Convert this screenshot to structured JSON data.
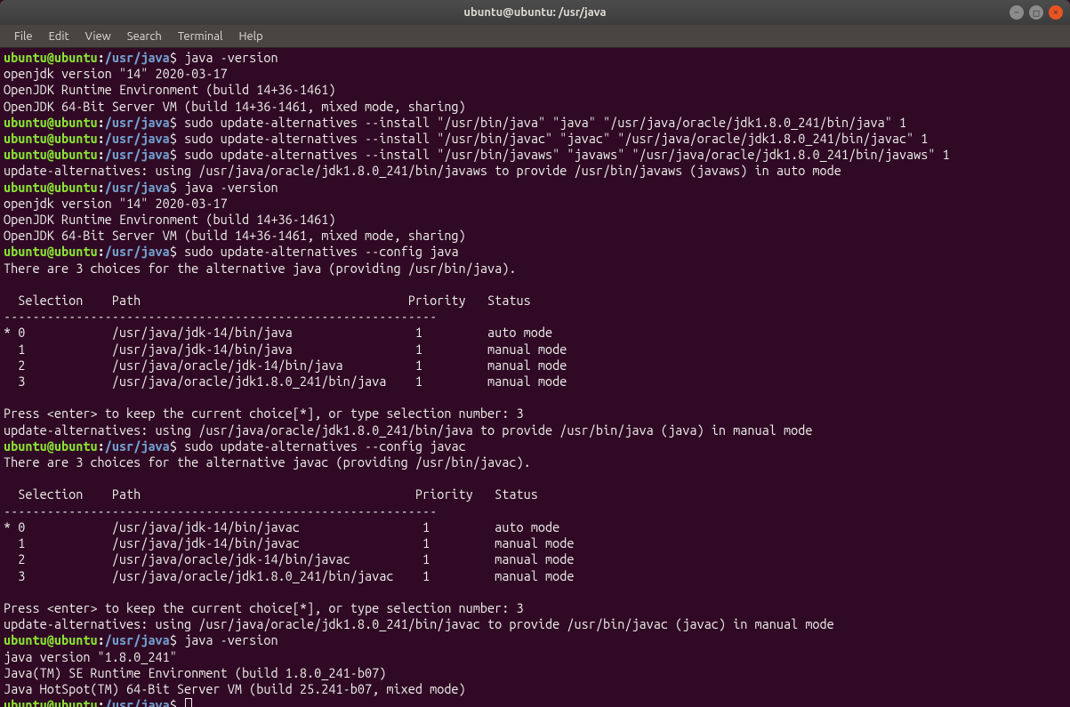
{
  "window": {
    "title": "ubuntu@ubuntu: /usr/java"
  },
  "menubar": {
    "items": [
      "File",
      "Edit",
      "View",
      "Search",
      "Terminal",
      "Help"
    ]
  },
  "prompt": {
    "user": "ubuntu",
    "at": "@",
    "host": "ubuntu",
    "colon": ":",
    "path": "/usr/java",
    "dollar": "$ "
  },
  "cmd": {
    "ver1": "java -version",
    "ua1": "sudo update-alternatives --install \"/usr/bin/java\" \"java\" \"/usr/java/oracle/jdk1.8.0_241/bin/java\" 1",
    "ua2": "sudo update-alternatives --install \"/usr/bin/javac\" \"javac\" \"/usr/java/oracle/jdk1.8.0_241/bin/javac\" 1",
    "ua3": "sudo update-alternatives --install \"/usr/bin/javaws\" \"javaws\" \"/usr/java/oracle/jdk1.8.0_241/bin/javaws\" 1",
    "ver2": "java -version",
    "cfg1": "sudo update-alternatives --config java",
    "cfg2": "sudo update-alternatives --config javac",
    "ver3": "java -version"
  },
  "out": {
    "o1": "openjdk version \"14\" 2020-03-17",
    "o2": "OpenJDK Runtime Environment (build 14+36-1461)",
    "o3": "OpenJDK 64-Bit Server VM (build 14+36-1461, mixed mode, sharing)",
    "o4": "update-alternatives: using /usr/java/oracle/jdk1.8.0_241/bin/javaws to provide /usr/bin/javaws (javaws) in auto mode",
    "o5": "openjdk version \"14\" 2020-03-17",
    "o6": "OpenJDK Runtime Environment (build 14+36-1461)",
    "o7": "OpenJDK 64-Bit Server VM (build 14+36-1461, mixed mode, sharing)",
    "o8": "There are 3 choices for the alternative java (providing /usr/bin/java).",
    "blank": "",
    "hdr1": "  Selection    Path                                     Priority   Status",
    "sep1": "------------------------------------------------------------",
    "r1a": "* 0            /usr/java/jdk-14/bin/java                 1         auto mode",
    "r1b": "  1            /usr/java/jdk-14/bin/java                 1         manual mode",
    "r1c": "  2            /usr/java/oracle/jdk-14/bin/java          1         manual mode",
    "r1d": "  3            /usr/java/oracle/jdk1.8.0_241/bin/java    1         manual mode",
    "p1": "Press <enter> to keep the current choice[*], or type selection number: 3",
    "o9": "update-alternatives: using /usr/java/oracle/jdk1.8.0_241/bin/java to provide /usr/bin/java (java) in manual mode",
    "o10": "There are 3 choices for the alternative javac (providing /usr/bin/javac).",
    "hdr2": "  Selection    Path                                      Priority   Status",
    "sep2": "------------------------------------------------------------",
    "r2a": "* 0            /usr/java/jdk-14/bin/javac                 1         auto mode",
    "r2b": "  1            /usr/java/jdk-14/bin/javac                 1         manual mode",
    "r2c": "  2            /usr/java/oracle/jdk-14/bin/javac          1         manual mode",
    "r2d": "  3            /usr/java/oracle/jdk1.8.0_241/bin/javac    1         manual mode",
    "p2": "Press <enter> to keep the current choice[*], or type selection number: 3",
    "o11": "update-alternatives: using /usr/java/oracle/jdk1.8.0_241/bin/javac to provide /usr/bin/javac (javac) in manual mode",
    "o12": "java version \"1.8.0_241\"",
    "o13": "Java(TM) SE Runtime Environment (build 1.8.0_241-b07)",
    "o14": "Java HotSpot(TM) 64-Bit Server VM (build 25.241-b07, mixed mode)"
  }
}
